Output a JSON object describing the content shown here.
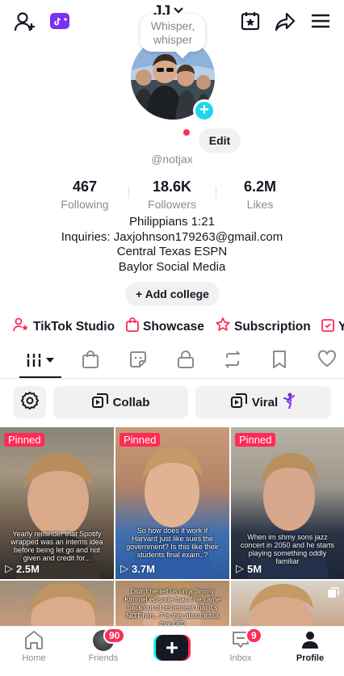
{
  "bubble_text": [
    "Whisper,",
    "whisper"
  ],
  "profile": {
    "display_name": "JJ",
    "handle": "@notjax",
    "edit_label": "Edit",
    "stats": [
      {
        "value": "467",
        "label": "Following"
      },
      {
        "value": "18.6K",
        "label": "Followers"
      },
      {
        "value": "6.2M",
        "label": "Likes"
      }
    ],
    "bio": [
      "Philippians 1:21",
      "Inquiries: Jaxjohnson179263@gmail.com",
      "Central Texas ESPN",
      "Baylor Social Media"
    ],
    "add_college_label": "Add college"
  },
  "links": [
    "TikTok Studio",
    "Showcase",
    "Subscription",
    "Y"
  ],
  "filters": {
    "collab_label": "Collab",
    "viral_label": "Viral"
  },
  "videos": [
    {
      "pinned": "Pinned",
      "views": "2.5M",
      "caption": "Yearly reminder that Spotify wrapped was an interns idea before being let go and not given and credit for..."
    },
    {
      "pinned": "Pinned",
      "views": "3.7M",
      "caption": "So how does it work if Harvard just like sues the government? Is this like their students final exam..?"
    },
    {
      "pinned": "Pinned",
      "views": "5M",
      "caption": "When im shmy sons jazz concert in 2050 and he starts playing something oddly familiar"
    },
    {
      "caption": ""
    },
    {
      "caption": "Didn't he tell us on a Jimmy Kimmel episode that if he came back out of retirement that it's NOT him...? Is this about it but that DID"
    },
    {
      "caption": ""
    }
  ],
  "nav": {
    "home": "Home",
    "friends": "Friends",
    "friends_badge": "90",
    "inbox": "Inbox",
    "inbox_badge": "9",
    "profile": "Profile"
  },
  "colors": {
    "accent": "#fe2c55",
    "cyan": "#20d5ec",
    "text": "#161823",
    "muted": "#8a8b91",
    "chip": "#f1f1f2",
    "studio": "#7b2ff7"
  }
}
